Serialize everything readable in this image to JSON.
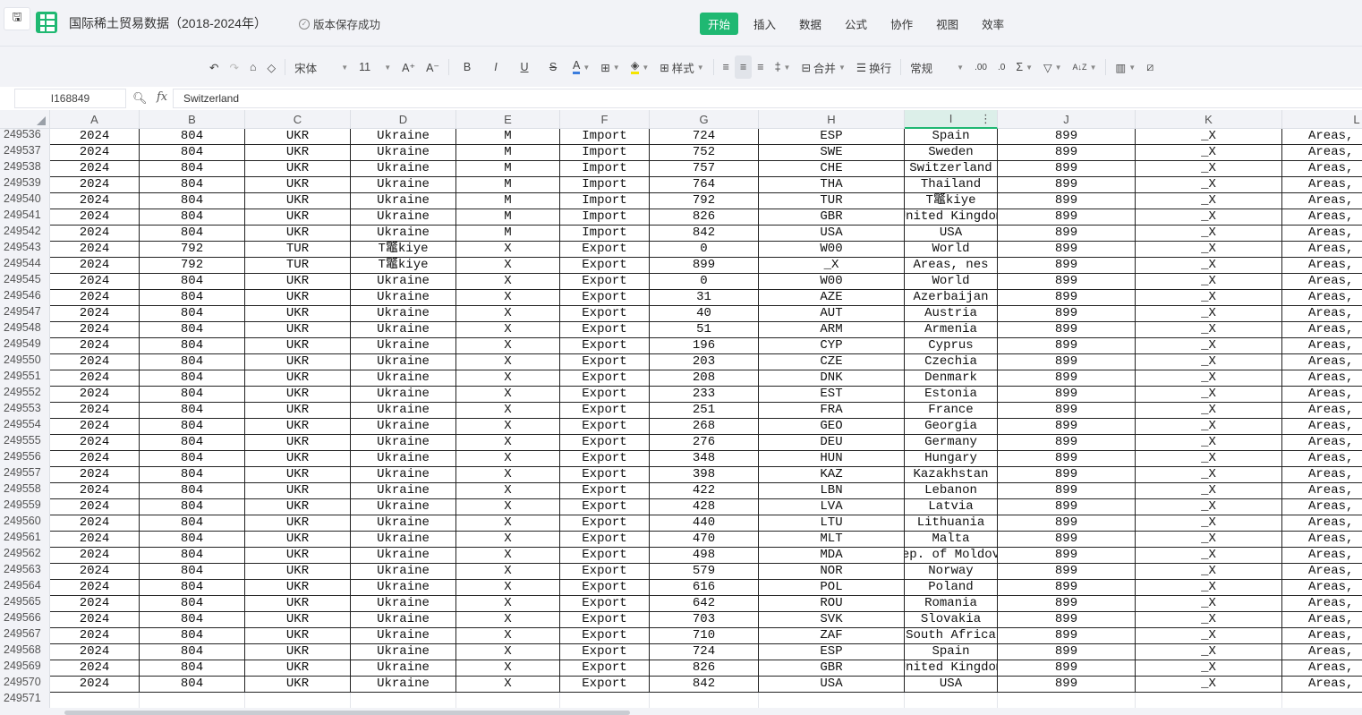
{
  "app": {
    "title": "国际稀土贸易数据（2018-2024年）",
    "save_status": "版本保存成功",
    "save_icon": "save-icon"
  },
  "menu": [
    "开始",
    "插入",
    "数据",
    "公式",
    "协作",
    "视图",
    "效率"
  ],
  "toolbar": {
    "font": "宋体",
    "font_size": "11",
    "bold": "B",
    "italic": "I",
    "underline": "U",
    "strike": "S",
    "font_color": "A",
    "style": "样式",
    "merge": "合并",
    "wrap": "换行",
    "number_format": "常规",
    "grow": "A⁺",
    "shrink": "A⁻",
    "sum": "Σ",
    "sort": "A↓Z",
    "dec_inc": ".00",
    "dec_dec": ".0"
  },
  "formula_bar": {
    "cell_ref": "I168849",
    "value": "Switzerland",
    "fx": "fx"
  },
  "columns": [
    "A",
    "B",
    "C",
    "D",
    "E",
    "F",
    "G",
    "H",
    "I",
    "J",
    "K",
    "L"
  ],
  "selected_column": "I",
  "rows": [
    [
      "249536",
      "2024",
      "804",
      "UKR",
      "Ukraine",
      "M",
      "Import",
      "724",
      "ESP",
      "Spain",
      "899",
      "_X",
      "Areas, nes"
    ],
    [
      "249537",
      "2024",
      "804",
      "UKR",
      "Ukraine",
      "M",
      "Import",
      "752",
      "SWE",
      "Sweden",
      "899",
      "_X",
      "Areas, nes"
    ],
    [
      "249538",
      "2024",
      "804",
      "UKR",
      "Ukraine",
      "M",
      "Import",
      "757",
      "CHE",
      "Switzerland",
      "899",
      "_X",
      "Areas, nes"
    ],
    [
      "249539",
      "2024",
      "804",
      "UKR",
      "Ukraine",
      "M",
      "Import",
      "764",
      "THA",
      "Thailand",
      "899",
      "_X",
      "Areas, nes"
    ],
    [
      "249540",
      "2024",
      "804",
      "UKR",
      "Ukraine",
      "M",
      "Import",
      "792",
      "TUR",
      "T鼈kiye",
      "899",
      "_X",
      "Areas, nes"
    ],
    [
      "249541",
      "2024",
      "804",
      "UKR",
      "Ukraine",
      "M",
      "Import",
      "826",
      "GBR",
      "United Kingdom",
      "899",
      "_X",
      "Areas, nes"
    ],
    [
      "249542",
      "2024",
      "804",
      "UKR",
      "Ukraine",
      "M",
      "Import",
      "842",
      "USA",
      "USA",
      "899",
      "_X",
      "Areas, nes"
    ],
    [
      "249543",
      "2024",
      "792",
      "TUR",
      "T鼈kiye",
      "X",
      "Export",
      "0",
      "W00",
      "World",
      "899",
      "_X",
      "Areas, nes"
    ],
    [
      "249544",
      "2024",
      "792",
      "TUR",
      "T鼈kiye",
      "X",
      "Export",
      "899",
      "_X",
      "Areas, nes",
      "899",
      "_X",
      "Areas, nes"
    ],
    [
      "249545",
      "2024",
      "804",
      "UKR",
      "Ukraine",
      "X",
      "Export",
      "0",
      "W00",
      "World",
      "899",
      "_X",
      "Areas, nes"
    ],
    [
      "249546",
      "2024",
      "804",
      "UKR",
      "Ukraine",
      "X",
      "Export",
      "31",
      "AZE",
      "Azerbaijan",
      "899",
      "_X",
      "Areas, nes"
    ],
    [
      "249547",
      "2024",
      "804",
      "UKR",
      "Ukraine",
      "X",
      "Export",
      "40",
      "AUT",
      "Austria",
      "899",
      "_X",
      "Areas, nes"
    ],
    [
      "249548",
      "2024",
      "804",
      "UKR",
      "Ukraine",
      "X",
      "Export",
      "51",
      "ARM",
      "Armenia",
      "899",
      "_X",
      "Areas, nes"
    ],
    [
      "249549",
      "2024",
      "804",
      "UKR",
      "Ukraine",
      "X",
      "Export",
      "196",
      "CYP",
      "Cyprus",
      "899",
      "_X",
      "Areas, nes"
    ],
    [
      "249550",
      "2024",
      "804",
      "UKR",
      "Ukraine",
      "X",
      "Export",
      "203",
      "CZE",
      "Czechia",
      "899",
      "_X",
      "Areas, nes"
    ],
    [
      "249551",
      "2024",
      "804",
      "UKR",
      "Ukraine",
      "X",
      "Export",
      "208",
      "DNK",
      "Denmark",
      "899",
      "_X",
      "Areas, nes"
    ],
    [
      "249552",
      "2024",
      "804",
      "UKR",
      "Ukraine",
      "X",
      "Export",
      "233",
      "EST",
      "Estonia",
      "899",
      "_X",
      "Areas, nes"
    ],
    [
      "249553",
      "2024",
      "804",
      "UKR",
      "Ukraine",
      "X",
      "Export",
      "251",
      "FRA",
      "France",
      "899",
      "_X",
      "Areas, nes"
    ],
    [
      "249554",
      "2024",
      "804",
      "UKR",
      "Ukraine",
      "X",
      "Export",
      "268",
      "GEO",
      "Georgia",
      "899",
      "_X",
      "Areas, nes"
    ],
    [
      "249555",
      "2024",
      "804",
      "UKR",
      "Ukraine",
      "X",
      "Export",
      "276",
      "DEU",
      "Germany",
      "899",
      "_X",
      "Areas, nes"
    ],
    [
      "249556",
      "2024",
      "804",
      "UKR",
      "Ukraine",
      "X",
      "Export",
      "348",
      "HUN",
      "Hungary",
      "899",
      "_X",
      "Areas, nes"
    ],
    [
      "249557",
      "2024",
      "804",
      "UKR",
      "Ukraine",
      "X",
      "Export",
      "398",
      "KAZ",
      "Kazakhstan",
      "899",
      "_X",
      "Areas, nes"
    ],
    [
      "249558",
      "2024",
      "804",
      "UKR",
      "Ukraine",
      "X",
      "Export",
      "422",
      "LBN",
      "Lebanon",
      "899",
      "_X",
      "Areas, nes"
    ],
    [
      "249559",
      "2024",
      "804",
      "UKR",
      "Ukraine",
      "X",
      "Export",
      "428",
      "LVA",
      "Latvia",
      "899",
      "_X",
      "Areas, nes"
    ],
    [
      "249560",
      "2024",
      "804",
      "UKR",
      "Ukraine",
      "X",
      "Export",
      "440",
      "LTU",
      "Lithuania",
      "899",
      "_X",
      "Areas, nes"
    ],
    [
      "249561",
      "2024",
      "804",
      "UKR",
      "Ukraine",
      "X",
      "Export",
      "470",
      "MLT",
      "Malta",
      "899",
      "_X",
      "Areas, nes"
    ],
    [
      "249562",
      "2024",
      "804",
      "UKR",
      "Ukraine",
      "X",
      "Export",
      "498",
      "MDA",
      "Rep. of Moldova",
      "899",
      "_X",
      "Areas, nes"
    ],
    [
      "249563",
      "2024",
      "804",
      "UKR",
      "Ukraine",
      "X",
      "Export",
      "579",
      "NOR",
      "Norway",
      "899",
      "_X",
      "Areas, nes"
    ],
    [
      "249564",
      "2024",
      "804",
      "UKR",
      "Ukraine",
      "X",
      "Export",
      "616",
      "POL",
      "Poland",
      "899",
      "_X",
      "Areas, nes"
    ],
    [
      "249565",
      "2024",
      "804",
      "UKR",
      "Ukraine",
      "X",
      "Export",
      "642",
      "ROU",
      "Romania",
      "899",
      "_X",
      "Areas, nes"
    ],
    [
      "249566",
      "2024",
      "804",
      "UKR",
      "Ukraine",
      "X",
      "Export",
      "703",
      "SVK",
      "Slovakia",
      "899",
      "_X",
      "Areas, nes"
    ],
    [
      "249567",
      "2024",
      "804",
      "UKR",
      "Ukraine",
      "X",
      "Export",
      "710",
      "ZAF",
      "South Africa",
      "899",
      "_X",
      "Areas, nes"
    ],
    [
      "249568",
      "2024",
      "804",
      "UKR",
      "Ukraine",
      "X",
      "Export",
      "724",
      "ESP",
      "Spain",
      "899",
      "_X",
      "Areas, nes"
    ],
    [
      "249569",
      "2024",
      "804",
      "UKR",
      "Ukraine",
      "X",
      "Export",
      "826",
      "GBR",
      "United Kingdom",
      "899",
      "_X",
      "Areas, nes"
    ],
    [
      "249570",
      "2024",
      "804",
      "UKR",
      "Ukraine",
      "X",
      "Export",
      "842",
      "USA",
      "USA",
      "899",
      "_X",
      "Areas, nes"
    ]
  ],
  "empty_row": "249571",
  "colors": {
    "accent": "#1fb872",
    "font_color_bar": "#3b7ddd",
    "fill_color_bar": "#f5e400"
  }
}
